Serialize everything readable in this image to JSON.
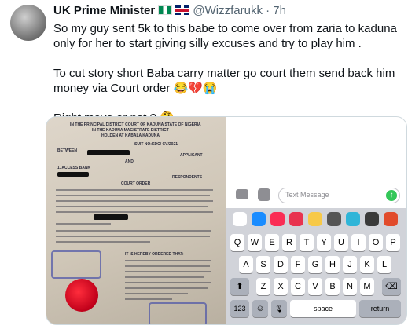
{
  "tweet": {
    "display_name": "UK Prime Minister",
    "handle": "@Wizzfarukk",
    "separator": "·",
    "time": "7h",
    "paragraphs": [
      "So my guy sent 5k to this babe to come over from zaria to kaduna only for her to start giving silly excuses and try to play him .",
      "To cut story short Baba carry matter go court them send back him money via Court order 😂💔😭",
      "Right move or not ? 🤔"
    ]
  },
  "document": {
    "title_1": "IN THE PRINCIPAL DISTRICT COURT OF KADUNA STATE OF NIGERIA",
    "title_2": "IN THE KADUNA MAGISTRATE DISTRICT",
    "title_3": "HOLDEN AT KABALA KADUNA",
    "suit_no": "SUIT NO:KDC/    CV/2021",
    "between": "BETWEEN",
    "applicant": "APPLICANT",
    "and": "AND",
    "respondent_1": "1. ACCESS BANK",
    "respondents": "RESPONDENTS",
    "court_order": "COURT ORDER",
    "ordered": "IT IS HEREBY ORDERED THAT:"
  },
  "phone": {
    "message_placeholder": "Text Message",
    "keys_row1": [
      "Q",
      "W",
      "E",
      "R",
      "T",
      "Y",
      "U",
      "I",
      "O",
      "P"
    ],
    "keys_row2": [
      "A",
      "S",
      "D",
      "F",
      "G",
      "H",
      "J",
      "K",
      "L"
    ],
    "keys_row3": [
      "Z",
      "X",
      "C",
      "V",
      "B",
      "N",
      "M"
    ],
    "shift": "⬆",
    "delete": "⌫",
    "numbers": "123",
    "emoji": "☺",
    "mic": "🎙",
    "space": "space",
    "return": "return"
  },
  "colors": {
    "verified_green": "#34c759",
    "text": "#0f1419",
    "muted": "#536471"
  }
}
